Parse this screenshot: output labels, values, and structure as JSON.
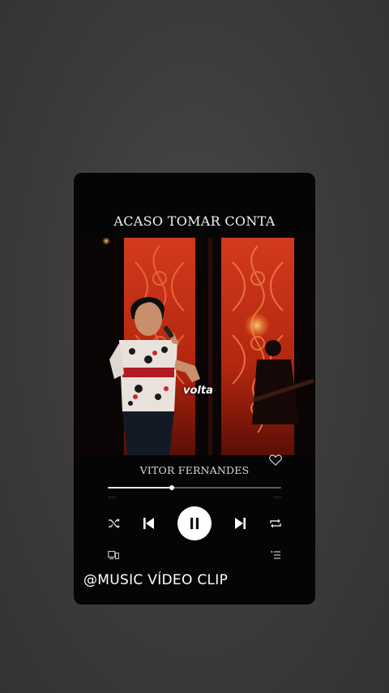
{
  "player": {
    "song_title": "ACASO TOMAR CONTA",
    "artist": "VITOR FERNANDES",
    "subtitle_word": "volta",
    "time_elapsed": "-:--",
    "time_total": "-:--",
    "progress": 0.37,
    "liked": false
  },
  "controls": [
    "shuffle-icon",
    "previous-icon",
    "pause-icon",
    "next-icon",
    "repeat-icon"
  ],
  "footer": {
    "left_icon": "devices-icon",
    "right_icon": "queue-icon"
  },
  "watermark": "@MUSIC VÍDEO CLIP",
  "colors": {
    "card_bg": "#050505",
    "accent_red": "#c2301a",
    "text": "#f2f2f2"
  }
}
